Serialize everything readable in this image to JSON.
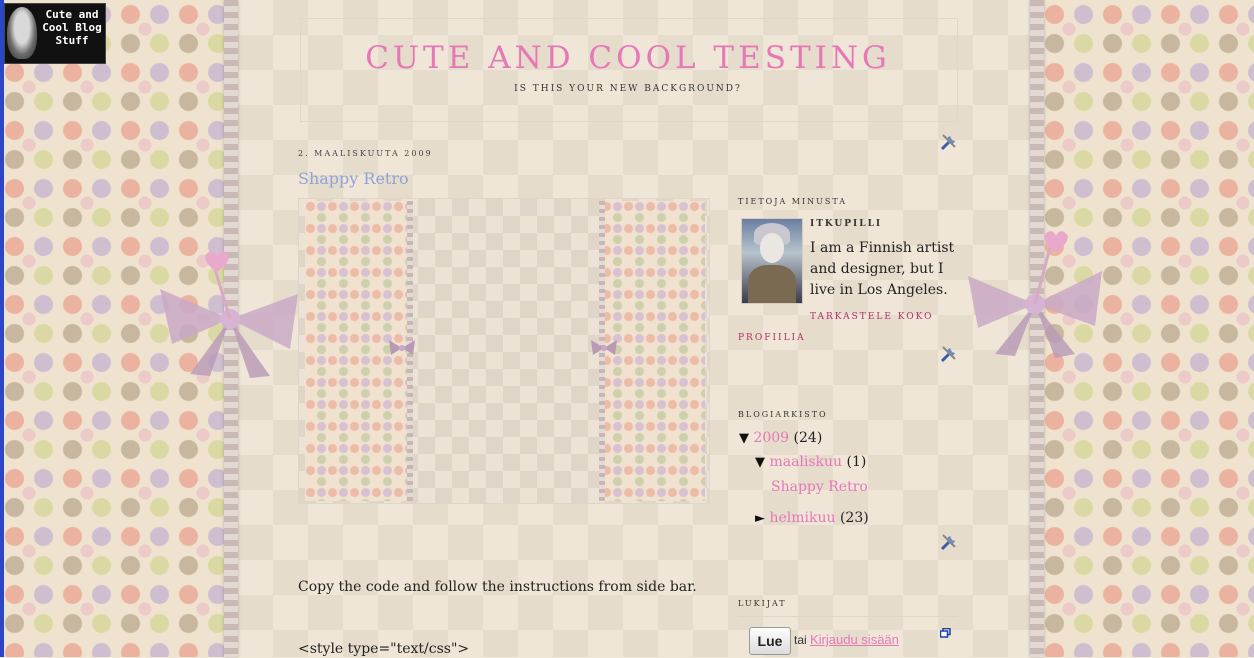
{
  "logo": {
    "text": "Cute and Cool Blog Stuff"
  },
  "header": {
    "title": "CUTE AND COOL TESTING",
    "description": "IS THIS YOUR NEW BACKGROUND?"
  },
  "post": {
    "date": "2. MAALISKUUTA 2009",
    "title": "Shappy Retro",
    "body": "Copy the code and follow the instructions from side bar.",
    "code": "<style type=\"text/css\">"
  },
  "sidebar": {
    "about": {
      "heading": "TIETOJA MINUSTA",
      "name": "ITKUPILLI",
      "text": "I am a Finnish artist and designer, but I live in Los Angeles.",
      "link_line1": "TARKASTELE KOKO",
      "link_line2": "PROFIILIA"
    },
    "archive": {
      "heading": "BLOGIARKISTO",
      "year": {
        "toggle": "▼",
        "label": "2009",
        "count": "(24)"
      },
      "months": [
        {
          "toggle": "▼",
          "label": "maaliskuu",
          "count": "(1)",
          "posts": [
            "Shappy Retro"
          ]
        },
        {
          "toggle": "►",
          "label": "helmikuu",
          "count": "(23)"
        }
      ]
    },
    "followers": {
      "heading": "LUKIJAT",
      "button": "Lue",
      "or": "tai",
      "signin": "Kirjaudu sisään"
    }
  },
  "colors": {
    "accent": "#e678b8",
    "post_title": "#8fa4d8",
    "profile_link": "#b0306a"
  }
}
